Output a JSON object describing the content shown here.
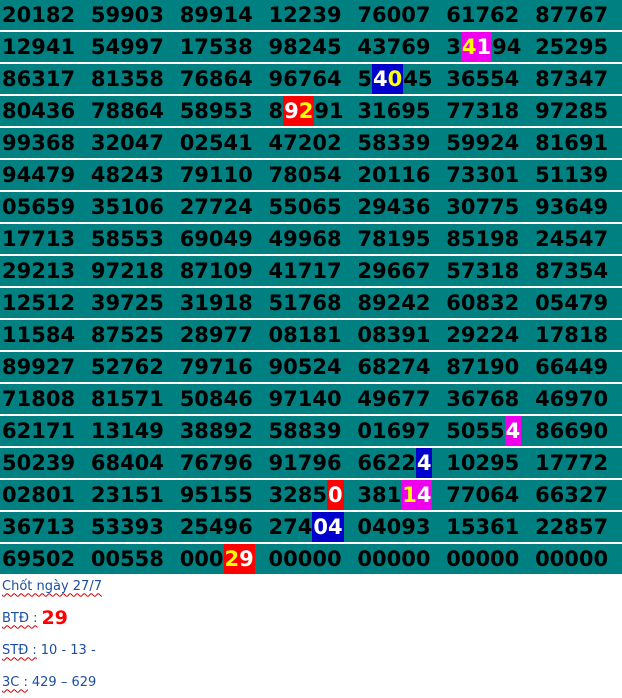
{
  "rows": [
    [
      "20182",
      "59903",
      "89914",
      "12239",
      "76007",
      "61762",
      "87767"
    ],
    [
      "12941",
      "54997",
      "17538",
      "98245",
      "43769",
      "34194",
      "25295"
    ],
    [
      "86317",
      "81358",
      "76864",
      "96764",
      "54045",
      "36554",
      "87347"
    ],
    [
      "80436",
      "78864",
      "58953",
      "89291",
      "31695",
      "77318",
      "97285"
    ],
    [
      "99368",
      "32047",
      "02541",
      "47202",
      "58339",
      "59924",
      "81691"
    ],
    [
      "94479",
      "48243",
      "79110",
      "78054",
      "20116",
      "73301",
      "51139"
    ],
    [
      "05659",
      "35106",
      "27724",
      "55065",
      "29436",
      "30775",
      "93649"
    ],
    [
      "17713",
      "58553",
      "69049",
      "49968",
      "78195",
      "85198",
      "24547"
    ],
    [
      "29213",
      "97218",
      "87109",
      "41717",
      "29667",
      "57318",
      "87354"
    ],
    [
      "12512",
      "39725",
      "31918",
      "51768",
      "89242",
      "60832",
      "05479"
    ],
    [
      "11584",
      "87525",
      "28977",
      "08181",
      "08391",
      "29224",
      "17818"
    ],
    [
      "89927",
      "52762",
      "79716",
      "90524",
      "68274",
      "87190",
      "66449"
    ],
    [
      "71808",
      "81571",
      "50846",
      "97140",
      "49677",
      "36768",
      "46970"
    ],
    [
      "62171",
      "13149",
      "38892",
      "58839",
      "01697",
      "50554",
      "86690"
    ],
    [
      "50239",
      "68404",
      "76796",
      "91796",
      "66224",
      "10295",
      "17772"
    ],
    [
      "02801",
      "23151",
      "95155",
      "32850",
      "38114",
      "77064",
      "66327"
    ],
    [
      "36713",
      "53393",
      "25496",
      "27404",
      "04093",
      "15361",
      "22857"
    ],
    [
      "69502",
      "00558",
      "00029",
      "00000",
      "00000",
      "00000",
      "00000"
    ]
  ],
  "highlights": [
    {
      "row": 1,
      "col": 5,
      "start": 1,
      "len": 2,
      "style": "magenta"
    },
    {
      "row": 2,
      "col": 4,
      "start": 1,
      "len": 2,
      "style": "blue"
    },
    {
      "row": 3,
      "col": 3,
      "start": 1,
      "len": 2,
      "style": "red"
    },
    {
      "row": 13,
      "col": 5,
      "start": 4,
      "len": 1,
      "style": "magenta"
    },
    {
      "row": 14,
      "col": 4,
      "start": 4,
      "len": 1,
      "style": "blue"
    },
    {
      "row": 15,
      "col": 3,
      "start": 4,
      "len": 1,
      "style": "red"
    },
    {
      "row": 15,
      "col": 4,
      "start": 3,
      "len": 2,
      "style": "magenta"
    },
    {
      "row": 16,
      "col": 3,
      "start": 3,
      "len": 2,
      "style": "blue"
    },
    {
      "row": 17,
      "col": 2,
      "start": 3,
      "len": 2,
      "style": "red"
    }
  ],
  "yellow_digits": [
    {
      "row": 1,
      "col": 5,
      "pos": 1
    },
    {
      "row": 2,
      "col": 4,
      "pos": 2
    },
    {
      "row": 3,
      "col": 3,
      "pos": 2
    },
    {
      "row": 15,
      "col": 4,
      "pos": 3
    },
    {
      "row": 17,
      "col": 2,
      "pos": 3
    }
  ],
  "colors": {
    "cell_bg": "#008080",
    "magenta": "#ee00ee",
    "blue": "#0000cc",
    "red": "#ff0000",
    "yellow": "#ffff00",
    "note_text": "#1a4fa0"
  },
  "notes": {
    "chot_label": "Chốt ngày 27/7",
    "btd_label": "BTĐ :",
    "btd_value": "29",
    "std_label": "STĐ :",
    "std_value": "10 - 13 -",
    "c3_label": "3C :",
    "c3_value": "429  – 629"
  }
}
